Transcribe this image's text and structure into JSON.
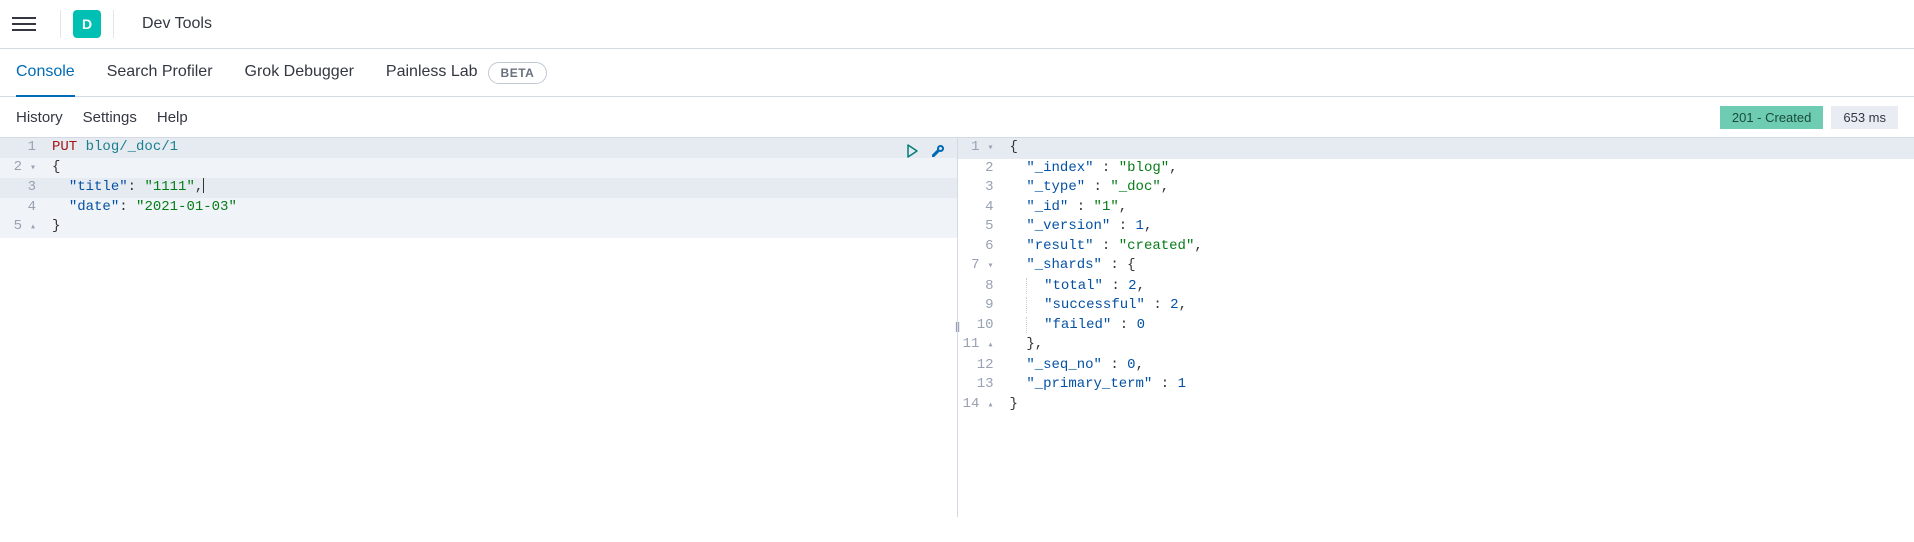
{
  "header": {
    "logo_letter": "D",
    "title": "Dev Tools"
  },
  "tabs": [
    {
      "label": "Console",
      "active": true
    },
    {
      "label": "Search Profiler",
      "active": false
    },
    {
      "label": "Grok Debugger",
      "active": false
    },
    {
      "label": "Painless Lab",
      "active": false,
      "badge": "BETA"
    }
  ],
  "toolbar": {
    "history": "History",
    "settings": "Settings",
    "help": "Help"
  },
  "status": {
    "code": "201 - Created",
    "time": "653 ms"
  },
  "request": {
    "method": "PUT",
    "path": "blog/_doc/1",
    "lines": [
      {
        "n": 1
      },
      {
        "n": 2,
        "fold": "▾",
        "text": "{"
      },
      {
        "n": 3,
        "indent": "  ",
        "key": "\"title\"",
        "val": "\"1111\"",
        "trail": ","
      },
      {
        "n": 4,
        "indent": "  ",
        "key": "\"date\"",
        "val": "\"2021-01-03\"",
        "trail": ""
      },
      {
        "n": 5,
        "fold": "▴",
        "text": "}"
      }
    ]
  },
  "response": {
    "lines": [
      {
        "n": 1,
        "fold": "▾",
        "text": "{"
      },
      {
        "n": 2,
        "indent": "  ",
        "key": "\"_index\"",
        "sep": " : ",
        "val": "\"blog\"",
        "vtype": "str",
        "trail": ","
      },
      {
        "n": 3,
        "indent": "  ",
        "key": "\"_type\"",
        "sep": " : ",
        "val": "\"_doc\"",
        "vtype": "str",
        "trail": ","
      },
      {
        "n": 4,
        "indent": "  ",
        "key": "\"_id\"",
        "sep": " : ",
        "val": "\"1\"",
        "vtype": "str",
        "trail": ","
      },
      {
        "n": 5,
        "indent": "  ",
        "key": "\"_version\"",
        "sep": " : ",
        "val": "1",
        "vtype": "num",
        "trail": ","
      },
      {
        "n": 6,
        "indent": "  ",
        "key": "\"result\"",
        "sep": " : ",
        "val": "\"created\"",
        "vtype": "str",
        "trail": ","
      },
      {
        "n": 7,
        "fold": "▾",
        "indent": "  ",
        "key": "\"_shards\"",
        "sep": " : ",
        "text": "{"
      },
      {
        "n": 8,
        "indent": "    ",
        "guide": true,
        "key": "\"total\"",
        "sep": " : ",
        "val": "2",
        "vtype": "num",
        "trail": ","
      },
      {
        "n": 9,
        "indent": "    ",
        "guide": true,
        "key": "\"successful\"",
        "sep": " : ",
        "val": "2",
        "vtype": "num",
        "trail": ","
      },
      {
        "n": 10,
        "indent": "    ",
        "guide": true,
        "key": "\"failed\"",
        "sep": " : ",
        "val": "0",
        "vtype": "num",
        "trail": ""
      },
      {
        "n": 11,
        "fold": "▴",
        "indent": "  ",
        "text": "},",
        "close": true
      },
      {
        "n": 12,
        "indent": "  ",
        "key": "\"_seq_no\"",
        "sep": " : ",
        "val": "0",
        "vtype": "num",
        "trail": ","
      },
      {
        "n": 13,
        "indent": "  ",
        "key": "\"_primary_term\"",
        "sep": " : ",
        "val": "1",
        "vtype": "num",
        "trail": ""
      },
      {
        "n": 14,
        "fold": "▴",
        "text": "}"
      }
    ]
  }
}
